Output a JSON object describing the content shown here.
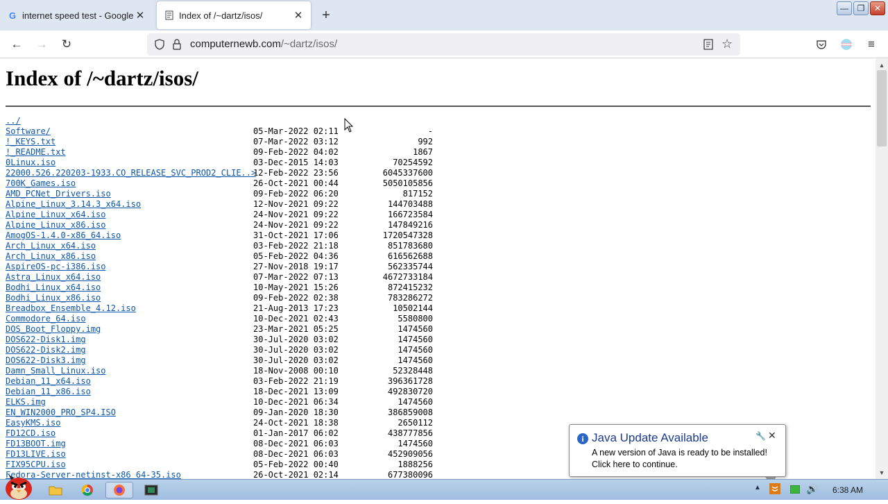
{
  "tabs": [
    {
      "title": "internet speed test - Google",
      "favicon": "google-g"
    },
    {
      "title": "Index of /~dartz/isos/",
      "favicon": "page-icon"
    }
  ],
  "newtab_label": "+",
  "window_buttons": {
    "minimize": "—",
    "restore": "❐",
    "close": "✕"
  },
  "address": {
    "host": "computernewb.com",
    "path": "/~dartz/isos/"
  },
  "page": {
    "heading": "Index of /~dartz/isos/",
    "parent_link": "../",
    "entries": [
      {
        "name": "Software/",
        "date": "05-Mar-2022 02:11",
        "size": "-"
      },
      {
        "name": "!_KEYS.txt",
        "date": "07-Mar-2022 03:12",
        "size": "992"
      },
      {
        "name": "!_README.txt",
        "date": "09-Feb-2022 04:02",
        "size": "1867"
      },
      {
        "name": "0Linux.iso",
        "date": "03-Dec-2015 14:03",
        "size": "70254592"
      },
      {
        "name": "22000.526.220203-1933.CO_RELEASE_SVC_PROD2_CLIE..>",
        "date": "12-Feb-2022 23:56",
        "size": "6045337600"
      },
      {
        "name": "700K_Games.iso",
        "date": "26-Oct-2021 00:44",
        "size": "5050105856"
      },
      {
        "name": "AMD_PCNet_Drivers.iso",
        "date": "09-Feb-2022 06:20",
        "size": "817152"
      },
      {
        "name": "Alpine_Linux_3.14.3_x64.iso",
        "date": "12-Nov-2021 09:22",
        "size": "144703488"
      },
      {
        "name": "Alpine_Linux_x64.iso",
        "date": "24-Nov-2021 09:22",
        "size": "166723584"
      },
      {
        "name": "Alpine_Linux_x86.iso",
        "date": "24-Nov-2021 09:22",
        "size": "147849216"
      },
      {
        "name": "AmogOS-1.4.0-x86_64.iso",
        "date": "31-Oct-2021 17:06",
        "size": "1720547328"
      },
      {
        "name": "Arch_Linux_x64.iso",
        "date": "03-Feb-2022 21:18",
        "size": "851783680"
      },
      {
        "name": "Arch_Linux_x86.iso",
        "date": "05-Feb-2022 04:36",
        "size": "616562688"
      },
      {
        "name": "AspireOS-pc-i386.iso",
        "date": "27-Nov-2018 19:17",
        "size": "562335744"
      },
      {
        "name": "Astra_Linux_x64.iso",
        "date": "07-Mar-2022 07:13",
        "size": "4672733184"
      },
      {
        "name": "Bodhi_Linux_x64.iso",
        "date": "10-May-2021 15:26",
        "size": "872415232"
      },
      {
        "name": "Bodhi_Linux_x86.iso",
        "date": "09-Feb-2022 02:38",
        "size": "783286272"
      },
      {
        "name": "Breadbox_Ensemble_4.12.iso",
        "date": "21-Aug-2013 17:23",
        "size": "10502144"
      },
      {
        "name": "Commodore_64.iso",
        "date": "10-Dec-2021 02:43",
        "size": "5580800"
      },
      {
        "name": "DOS_Boot_Floppy.img",
        "date": "23-Mar-2021 05:25",
        "size": "1474560"
      },
      {
        "name": "DOS622-Disk1.img",
        "date": "30-Jul-2020 03:02",
        "size": "1474560"
      },
      {
        "name": "DOS622-Disk2.img",
        "date": "30-Jul-2020 03:02",
        "size": "1474560"
      },
      {
        "name": "DOS622-Disk3.img",
        "date": "30-Jul-2020 03:02",
        "size": "1474560"
      },
      {
        "name": "Damn_Small_Linux.iso",
        "date": "18-Nov-2008 00:10",
        "size": "52328448"
      },
      {
        "name": "Debian_11_x64.iso",
        "date": "03-Feb-2022 21:19",
        "size": "396361728"
      },
      {
        "name": "Debian_11_x86.iso",
        "date": "18-Dec-2021 13:09",
        "size": "492830720"
      },
      {
        "name": "ELKS.img",
        "date": "10-Dec-2021 06:34",
        "size": "1474560"
      },
      {
        "name": "EN_WIN2000_PRO_SP4.ISO",
        "date": "09-Jan-2020 18:30",
        "size": "386859008"
      },
      {
        "name": "EasyKMS.iso",
        "date": "24-Oct-2021 18:38",
        "size": "2650112"
      },
      {
        "name": "FD12CD.iso",
        "date": "01-Jan-2017 06:02",
        "size": "438777856"
      },
      {
        "name": "FD13BOOT.img",
        "date": "08-Dec-2021 06:03",
        "size": "1474560"
      },
      {
        "name": "FD13LIVE.iso",
        "date": "08-Dec-2021 06:03",
        "size": "452909056"
      },
      {
        "name": "FIX95CPU.iso",
        "date": "05-Feb-2022 00:40",
        "size": "1888256"
      },
      {
        "name": "Fedora-Server-netinst-x86_64-35.iso",
        "date": "26-Oct-2021 02:14",
        "size": "677380096"
      }
    ]
  },
  "java_popup": {
    "title": "Java Update Available",
    "line1": "A new version of Java is ready to be installed!",
    "line2": "Click here to continue."
  },
  "taskbar": {
    "clock": "6:38 AM"
  },
  "colors": {
    "link": "#0b56a8",
    "tabstrip": "#dde6f1",
    "taskbar": "#b9d1ea"
  }
}
